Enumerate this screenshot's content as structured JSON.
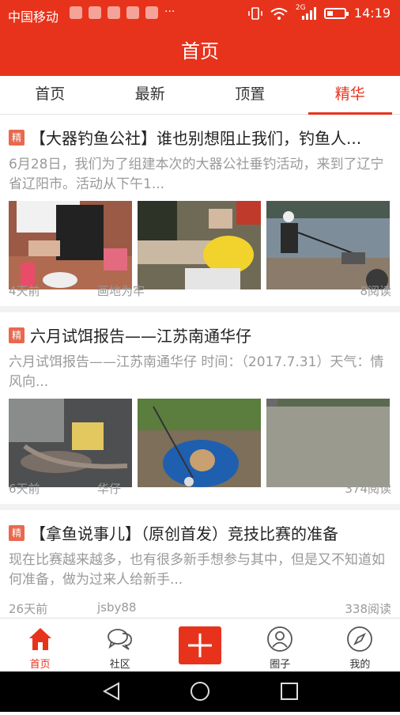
{
  "statusbar": {
    "carrier": "中国移动",
    "network": "2G",
    "time": "14:19",
    "battery_level": 0.35,
    "notif_more": "···"
  },
  "header": {
    "title": "首页"
  },
  "tabs": [
    {
      "label": "首页"
    },
    {
      "label": "最新"
    },
    {
      "label": "顶置"
    },
    {
      "label": "精华"
    }
  ],
  "active_tab": "精华",
  "posts": [
    {
      "badge": "精",
      "title": "【大器钓鱼公社】谁也别想阻止我们，钓鱼人...",
      "desc": "6月28日，我们为了组建本次的大器公社垂钓活动，来到了辽宁省辽阳市。活动从下午1...",
      "time": "4天前",
      "author": "画地为牢",
      "reads": "8阅读"
    },
    {
      "badge": "精",
      "title": "六月试饵报告——江苏南通华仔",
      "desc": "六月试饵报告——江苏南通华仔 时间：（2017.7.31）天气：情 风向...",
      "time": "6天前",
      "author": "华仔",
      "reads": "374阅读"
    },
    {
      "badge": "精",
      "title": "【拿鱼说事儿】（原创首发）竞技比赛的准备",
      "desc": "现在比赛越来越多，也有很多新手想参与其中，但是又不知道如何准备，做为过来人给新手...",
      "time": "26天前",
      "author": "jsby88",
      "reads": "338阅读"
    }
  ],
  "bottomnav": [
    {
      "label": "首页",
      "icon": "home-icon"
    },
    {
      "label": "社区",
      "icon": "chat-bubbles-icon"
    },
    {
      "label": "",
      "icon": "plus-icon"
    },
    {
      "label": "圈子",
      "icon": "profile-circle-icon"
    },
    {
      "label": "我的",
      "icon": "compass-icon"
    }
  ],
  "colors": {
    "brand": "#e8331c",
    "badge": "#e8694f",
    "muted": "#9a9a9a"
  }
}
